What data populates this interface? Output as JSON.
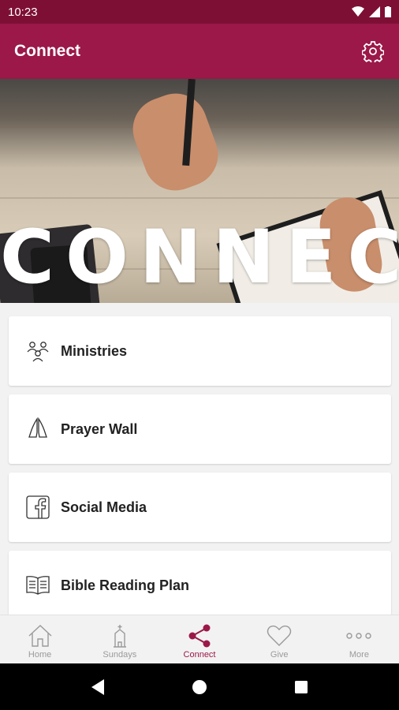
{
  "status_bar": {
    "time": "10:23"
  },
  "app_bar": {
    "title": "Connect"
  },
  "hero": {
    "title": "CONNECT"
  },
  "menu": [
    {
      "label": "Ministries",
      "icon": "people-group-icon"
    },
    {
      "label": "Prayer Wall",
      "icon": "praying-hands-icon"
    },
    {
      "label": "Social Media",
      "icon": "facebook-icon"
    },
    {
      "label": "Bible Reading Plan",
      "icon": "open-book-icon"
    }
  ],
  "bottom_nav": [
    {
      "label": "Home",
      "icon": "home-icon",
      "active": false
    },
    {
      "label": "Sundays",
      "icon": "church-icon",
      "active": false
    },
    {
      "label": "Connect",
      "icon": "share-icon",
      "active": true
    },
    {
      "label": "Give",
      "icon": "heart-icon",
      "active": false
    },
    {
      "label": "More",
      "icon": "more-dots-icon",
      "active": false
    }
  ],
  "colors": {
    "accent": "#9b1848",
    "status_bar": "#7d0f35",
    "inactive": "#9a9a9a"
  }
}
